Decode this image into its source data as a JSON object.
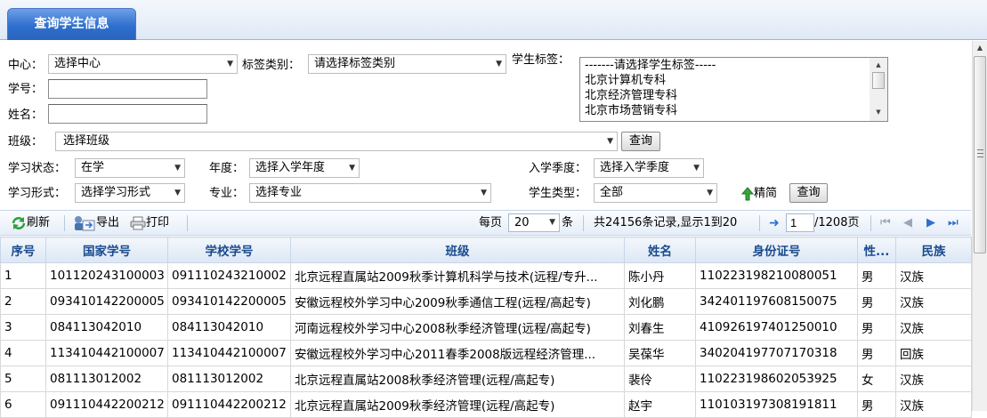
{
  "tab": {
    "title": "查询学生信息"
  },
  "filters": {
    "center_label": "中心：",
    "center_value": "选择中心",
    "tag_type_label": "标签类别：",
    "tag_type_value": "请选择标签类别",
    "student_tag_label": "学生标签：",
    "student_tag_options": [
      "-------请选择学生标签-----",
      "北京计算机专科",
      "北京经济管理专科",
      "北京市场营销专科"
    ],
    "student_no_label": "学号：",
    "student_no_value": "",
    "name_label": "姓名：",
    "name_value": "",
    "class_label": "班级：",
    "class_value": "选择班级",
    "query_button_1": "查询",
    "study_status_label": "学习状态：",
    "study_status_value": "在学",
    "year_label": "年度：",
    "year_value": "选择入学年度",
    "season_label": "入学季度：",
    "season_value": "选择入学季度",
    "study_form_label": "学习形式：",
    "study_form_value": "选择学习形式",
    "major_label": "专业：",
    "major_value": "选择专业",
    "student_type_label": "学生类型：",
    "student_type_value": "全部",
    "simplify_label": "精简",
    "query_button_2": "查询"
  },
  "toolbar": {
    "refresh": "刷新",
    "export": "导出",
    "print": "打印",
    "per_page_label": "每页",
    "per_page_value": "20",
    "per_page_unit": "条",
    "summary": "共24156条记录,显示1到20",
    "page_value": "1",
    "page_total": "/1208页"
  },
  "grid": {
    "columns": [
      "序号",
      "国家学号",
      "学校学号",
      "班级",
      "姓名",
      "身份证号",
      "性...",
      "民族"
    ],
    "rows": [
      {
        "seq": "1",
        "national_no": "101120243100003",
        "school_no": "091110243210002",
        "class": "北京远程直属站2009秋季计算机科学与技术(远程/专升...",
        "name": "陈小丹",
        "id_no": "110223198210080051",
        "gender": "男",
        "ethnic": "汉族"
      },
      {
        "seq": "2",
        "national_no": "093410142200005",
        "school_no": "093410142200005",
        "class": "安徽远程校外学习中心2009秋季通信工程(远程/高起专)",
        "name": "刘化鹏",
        "id_no": "342401197608150075",
        "gender": "男",
        "ethnic": "汉族"
      },
      {
        "seq": "3",
        "national_no": "084113042010",
        "school_no": "084113042010",
        "class": "河南远程校外学习中心2008秋季经济管理(远程/高起专)",
        "name": "刘春生",
        "id_no": "410926197401250010",
        "gender": "男",
        "ethnic": "汉族"
      },
      {
        "seq": "4",
        "national_no": "113410442100007",
        "school_no": "113410442100007",
        "class": "安徽远程校外学习中心2011春季2008版远程经济管理...",
        "name": "吴葆华",
        "id_no": "340204197707170318",
        "gender": "男",
        "ethnic": "回族"
      },
      {
        "seq": "5",
        "national_no": "081113012002",
        "school_no": "081113012002",
        "class": "北京远程直属站2008秋季经济管理(远程/高起专)",
        "name": "裴伶",
        "id_no": "110223198602053925",
        "gender": "女",
        "ethnic": "汉族"
      },
      {
        "seq": "6",
        "national_no": "091110442200212",
        "school_no": "091110442200212",
        "class": "北京远程直属站2009秋季经济管理(远程/高起专)",
        "name": "赵宇",
        "id_no": "110103197308191811",
        "gender": "男",
        "ethnic": "汉族"
      }
    ]
  }
}
